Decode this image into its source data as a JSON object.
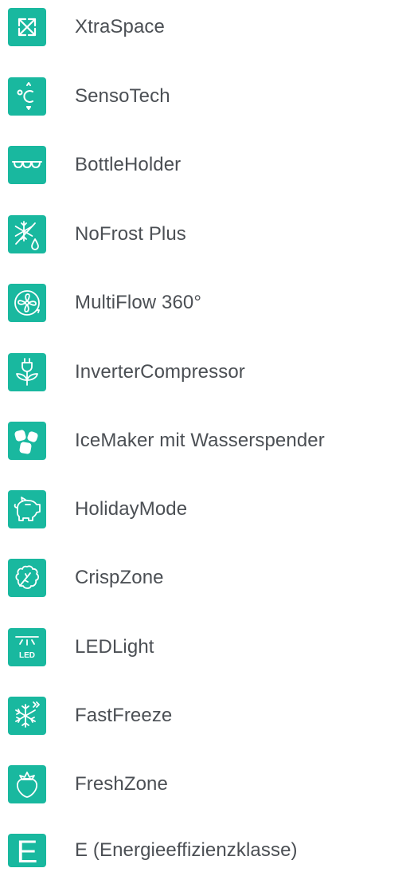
{
  "theme": {
    "accent": "#19b89f",
    "icon_foreground": "#ffffff",
    "text": "#4b4f54",
    "background": "#ffffff"
  },
  "features": [
    {
      "label": "XtraSpace",
      "icon": "expand-arrows-icon"
    },
    {
      "label": "SensoTech",
      "icon": "temperature-celsius-icon"
    },
    {
      "label": "BottleHolder",
      "icon": "bottle-holder-icon"
    },
    {
      "label": "NoFrost Plus",
      "icon": "no-frost-icon"
    },
    {
      "label": "MultiFlow 360°",
      "icon": "multiflow-fan-icon"
    },
    {
      "label": "InverterCompressor",
      "icon": "plug-leaf-icon"
    },
    {
      "label": "IceMaker mit Wasserspender",
      "icon": "ice-cubes-icon"
    },
    {
      "label": "HolidayMode",
      "icon": "piggy-bank-icon"
    },
    {
      "label": "CrispZone",
      "icon": "lettuce-icon"
    },
    {
      "label": "LEDLight",
      "icon": "led-light-icon",
      "icon_text": "LED"
    },
    {
      "label": "FastFreeze",
      "icon": "fast-freeze-snowflake-icon"
    },
    {
      "label": "FreshZone",
      "icon": "strawberry-icon"
    },
    {
      "label": "E (Energieeffizienzklasse)",
      "icon": "energy-class-e-icon",
      "icon_text": "E"
    }
  ]
}
